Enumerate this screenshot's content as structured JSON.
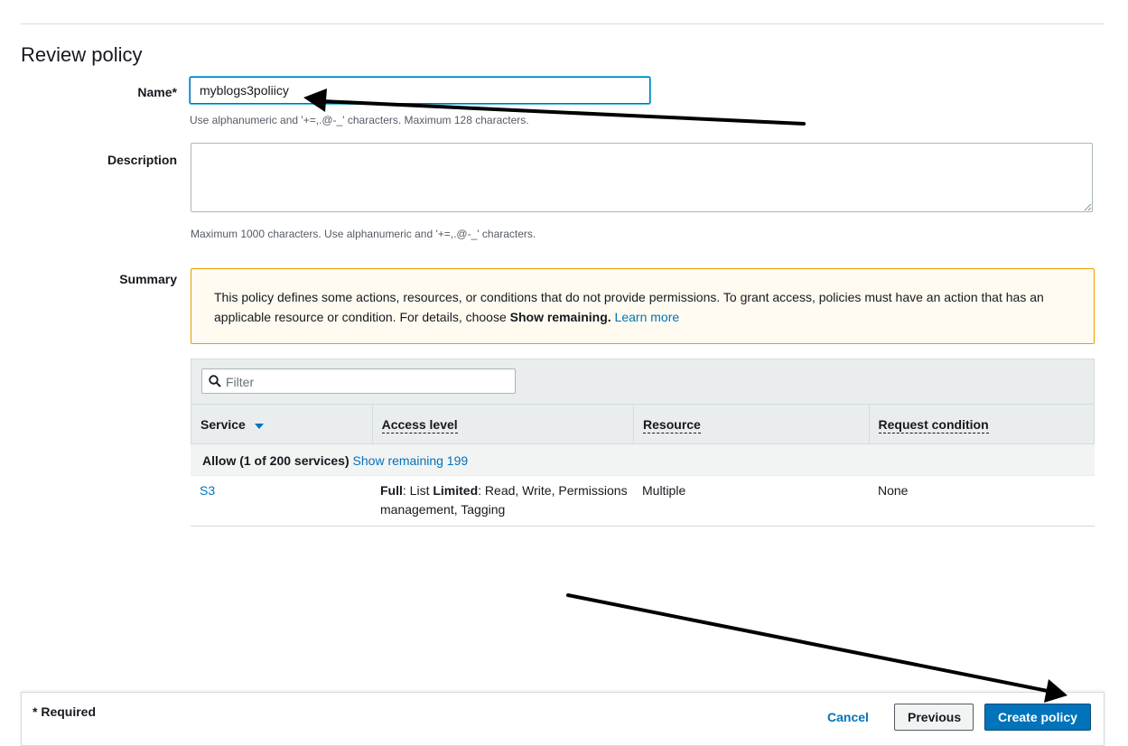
{
  "page": {
    "title": "Review policy"
  },
  "name_field": {
    "label": "Name*",
    "value": "myblogs3poliicy",
    "hint": "Use alphanumeric and '+=,.@-_' characters. Maximum 128 characters."
  },
  "description_field": {
    "label": "Description",
    "value": "",
    "hint": "Maximum 1000 characters. Use alphanumeric and '+=,.@-_' characters."
  },
  "summary": {
    "label": "Summary",
    "warning_text": "This policy defines some actions, resources, or conditions that do not provide permissions. To grant access, policies must have an action that has an applicable resource or condition. For details, choose ",
    "warning_bold": "Show remaining.",
    "warning_link": "Learn more",
    "filter_placeholder": "Filter",
    "columns": [
      "Service",
      "Access level",
      "Resource",
      "Request condition"
    ],
    "group": {
      "label": "Allow (1 of 200 services)",
      "link": "Show remaining 199"
    },
    "rows": [
      {
        "service": "S3",
        "access_full_label": "Full",
        "access_full_value": ": List ",
        "access_limited_label": "Limited",
        "access_limited_value": ": Read, Write, Permissions management, Tagging",
        "resource": "Multiple",
        "request_condition": "None"
      }
    ]
  },
  "footer": {
    "required_note": "* Required",
    "cancel_label": "Cancel",
    "previous_label": "Previous",
    "create_label": "Create policy"
  },
  "colors": {
    "link": "#0073bb",
    "primary_button": "#0073bb",
    "warning_border": "#eb9b00",
    "warning_bg": "#fffbf0"
  },
  "icons": [
    "search-icon",
    "sort-down-icon",
    "resize-grip-icon",
    "annotation-arrow-icon"
  ]
}
